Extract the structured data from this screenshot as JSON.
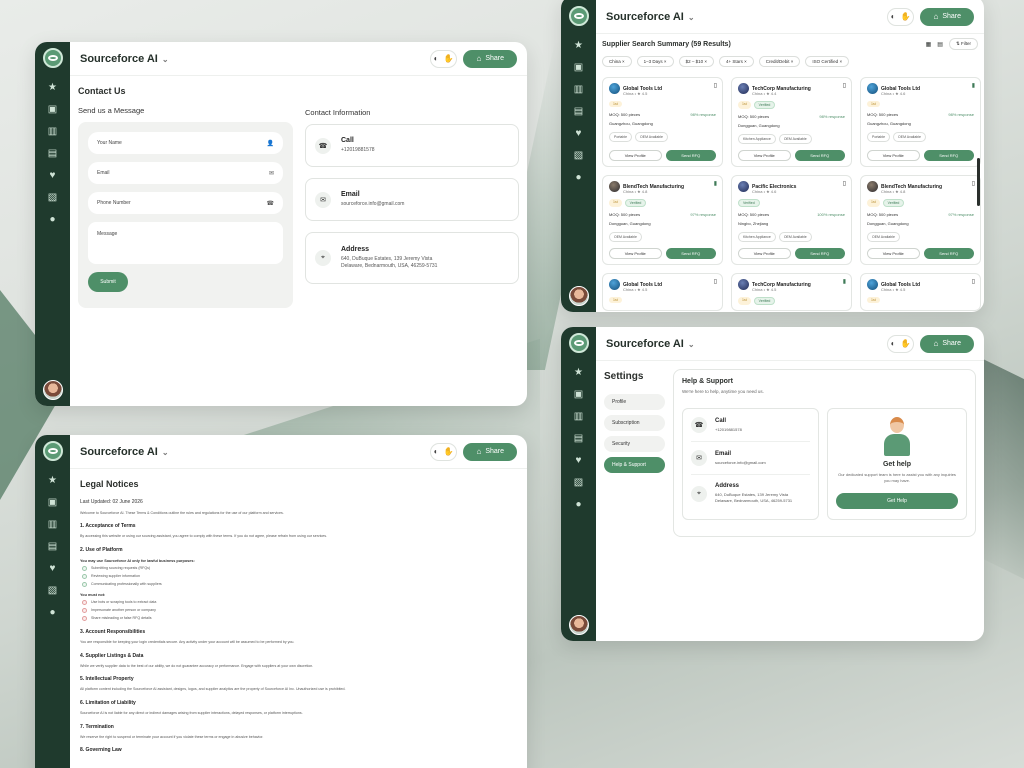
{
  "app": {
    "brand": "Sourceforce AI",
    "share_label": "Share"
  },
  "contact": {
    "title": "Contact Us",
    "form_heading": "Send us a Message",
    "fields": [
      {
        "label": "Your Name",
        "icon": "user-icon"
      },
      {
        "label": "Email",
        "icon": "mail-icon"
      },
      {
        "label": "Phone Number",
        "icon": "phone-icon"
      },
      {
        "label": "Message",
        "icon": ""
      }
    ],
    "submit": "Submit",
    "info_heading": "Contact Information",
    "cards": [
      {
        "title": "Call",
        "line1": "+12019881578",
        "line2": ""
      },
      {
        "title": "Email",
        "line1": "sourceforce.info@gmail.com",
        "line2": ""
      },
      {
        "title": "Address",
        "line1": "640, DuBuque Estates, 139 Jeremy Vista",
        "line2": "Delaware, Bednarmouth, USA, 46259-5731"
      }
    ]
  },
  "suppliers": {
    "title": "Supplier Search Summary (59 Results)",
    "filter_label": "Filter",
    "chips": [
      "China",
      "1–3 Days",
      "$2 – $10",
      "4+ Stars",
      "Credit/Debit",
      "ISO Certified"
    ],
    "cards": [
      {
        "name": "Global Tools Ltd",
        "meta": "China • ★ 4.5",
        "logo": "globe",
        "bookmarked": false,
        "badges": [
          "1st"
        ],
        "moq": "MOQ: 500 pieces",
        "response": "98% response",
        "location": "Guangzhou, Guangdong",
        "tags": [
          "Portable",
          "OEM Available"
        ],
        "view": "View Profile",
        "rfq": "Send RFQ"
      },
      {
        "name": "TechCorp Manufacturing",
        "meta": "China • ★ 4.4",
        "logo": "alt",
        "bookmarked": false,
        "badges": [
          "1st",
          "Verified"
        ],
        "moq": "MOQ: 500 pieces",
        "response": "98% response",
        "location": "Dongguan, Guangdong",
        "tags": [
          "Kitchen Appliance",
          "OEM Available"
        ],
        "view": "View Profile",
        "rfq": "Send RFQ"
      },
      {
        "name": "Global Tools Ltd",
        "meta": "China • ★ 4.6",
        "logo": "globe",
        "bookmarked": true,
        "badges": [
          "1st"
        ],
        "moq": "MOQ: 500 pieces",
        "response": "98% response",
        "location": "Guangzhou, Guangdong",
        "tags": [
          "Portable",
          "OEM Available"
        ],
        "view": "View Profile",
        "rfq": "Send RFQ"
      },
      {
        "name": "BlendTech Manufacturing",
        "meta": "China • ★ 4.8",
        "logo": "alt2",
        "bookmarked": true,
        "badges": [
          "1st",
          "Verified"
        ],
        "moq": "MOQ: 500 pieces",
        "response": "97% response",
        "location": "Dongguan, Guangdong",
        "tags": [
          "OEM Available"
        ],
        "view": "View Profile",
        "rfq": "Send RFQ"
      },
      {
        "name": "Pacific Electronics",
        "meta": "China • ★ 4.6",
        "logo": "alt",
        "bookmarked": false,
        "badges": [
          "Verified"
        ],
        "moq": "MOQ: 500 pieces",
        "response": "100% response",
        "location": "Ningbo, Zhejiang",
        "tags": [
          "Kitchen Appliance",
          "OEM Available"
        ],
        "view": "View Profile",
        "rfq": "Send RFQ"
      },
      {
        "name": "BlendTech Manufacturing",
        "meta": "China • ★ 4.8",
        "logo": "alt2",
        "bookmarked": false,
        "badges": [
          "1st",
          "Verified"
        ],
        "moq": "MOQ: 500 pieces",
        "response": "97% response",
        "location": "Dongguan, Guangdong",
        "tags": [
          "OEM Available"
        ],
        "view": "View Profile",
        "rfq": "Send RFQ"
      },
      {
        "name": "Global Tools Ltd",
        "meta": "China • ★ 4.5",
        "logo": "globe",
        "bookmarked": false,
        "badges": [
          "1st"
        ]
      },
      {
        "name": "TechCorp Manufacturing",
        "meta": "China • ★ 4.5",
        "logo": "alt",
        "bookmarked": true,
        "badges": [
          "1st",
          "Verified"
        ]
      },
      {
        "name": "Global Tools Ltd",
        "meta": "China • ★ 4.5",
        "logo": "globe",
        "bookmarked": false,
        "badges": [
          "1st"
        ]
      }
    ]
  },
  "settings": {
    "title": "Settings",
    "nav": [
      "Profile",
      "Subscription",
      "Security",
      "Help & Support"
    ],
    "active": "Help & Support",
    "panel_title": "Help & Support",
    "panel_sub": "We're here to help, anytime you need us.",
    "items": [
      {
        "title": "Call",
        "line1": "+12019881578",
        "line2": ""
      },
      {
        "title": "Email",
        "line1": "sourceforce.info@gmail.com",
        "line2": ""
      },
      {
        "title": "Address",
        "line1": "640, DuBuque Estates, 139 Jeremy Vista",
        "line2": "Delaware, Bednarmouth, USA, 46259-5731"
      }
    ],
    "help_title": "Get help",
    "help_text": "Our dedicated support team is here to assist you with any inquiries you may have.",
    "help_button": "Get Help"
  },
  "legal": {
    "title": "Legal Notices",
    "updated": "Last Updated: 02 June 2026",
    "intro": "Welcome to Sourceforce AI. These Terms & Conditions outline the rules and regulations for the use of our platform and services.",
    "s1_title": "1. Acceptance of Terms",
    "s1_body": "By accessing this website or using our sourcing assistant, you agree to comply with these terms. If you do not agree, please refrain from using our services.",
    "s2_title": "2. Use of Platform",
    "s2_may": "You may use Sourceforce AI only for lawful business purposes:",
    "s2_may_items": [
      "Submitting sourcing requests (RFQs)",
      "Reviewing supplier information",
      "Communicating professionally with suppliers"
    ],
    "s2_mustnot": "You must not:",
    "s2_mustnot_items": [
      "Use bots or scraping tools to extract data",
      "Impersonate another person or company",
      "Share misleading or false RFQ details"
    ],
    "s3_title": "3. Account Responsibilities",
    "s3_body": "You are responsible for keeping your login credentials secure. Any activity under your account will be assumed to be performed by you.",
    "s4_title": "4. Supplier Listings & Data",
    "s4_body": "While we verify supplier data to the best of our ability, we do not guarantee accuracy or performance. Engage with suppliers at your own discretion.",
    "s5_title": "5. Intellectual Property",
    "s5_body": "All platform content including the Sourceforce AI assistant, designs, logos, and supplier analytics are the property of Sourceforce AI Inc. Unauthorized use is prohibited.",
    "s6_title": "6. Limitation of Liability",
    "s6_body": "Sourceforce AI is not liable for any direct or indirect damages arising from supplier interactions, delayed responses, or platform interruptions.",
    "s7_title": "7. Termination",
    "s7_body": "We reserve the right to suspend or terminate your account if you violate these terms or engage in abusive behavior.",
    "s8_title": "8. Governing Law"
  },
  "colors": {
    "accent": "#4e8f68",
    "rail": "#1f3a2d"
  }
}
